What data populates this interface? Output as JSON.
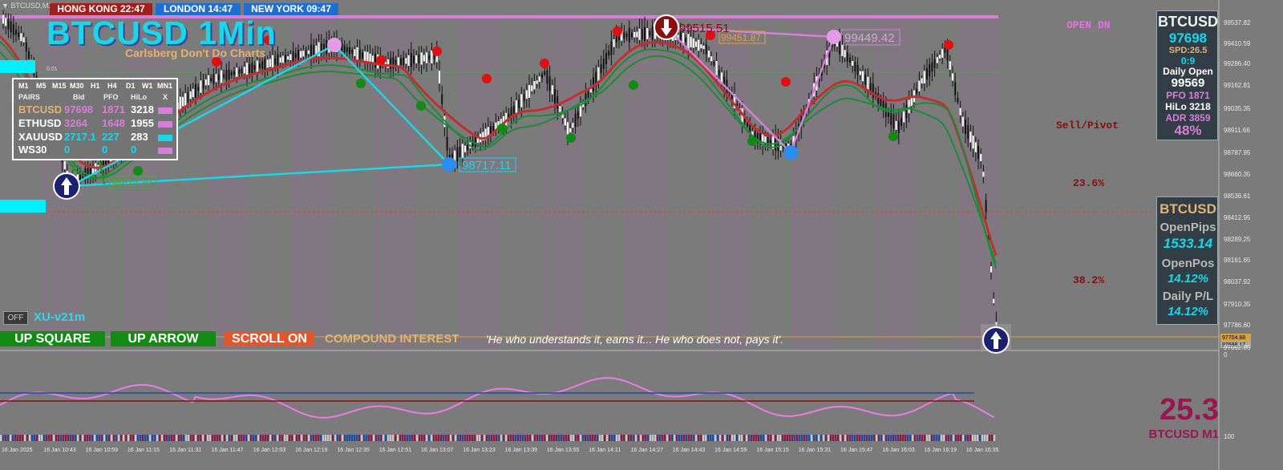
{
  "window": {
    "title": "▼ BTCUSD,M1"
  },
  "clocks": [
    {
      "label": "HONG KONG 22:47",
      "color": "#a02020"
    },
    {
      "label": "LONDON  14:47",
      "color": "#1f6fd0"
    },
    {
      "label": "NEW YORK  09:47",
      "color": "#1f6fd0"
    }
  ],
  "header": {
    "title": "BTCUSD 1Min",
    "tagline": "Carlsberg Don't Do Charts"
  },
  "pairs_panel": {
    "timeframes": [
      "M1",
      "M5",
      "M15",
      "M30",
      "H1",
      "H4",
      "D1",
      "W1",
      "MN1"
    ],
    "close_label": "X",
    "headers": {
      "pairs": "PAIRS",
      "bid": "Bid",
      "pfo": "PFO",
      "hilo": "HiLo"
    },
    "rows": [
      {
        "pair": "BTCUSD",
        "bid": "97698",
        "pfo": "1871",
        "hilo": "3218"
      },
      {
        "pair": "ETHUSD",
        "bid": "3264",
        "pfo": "1648",
        "hilo": "1955"
      },
      {
        "pair": "XAUUSD",
        "bid": "2717.1",
        "pfo": "227",
        "hilo": "283"
      },
      {
        "pair": "WS30",
        "bid": "0",
        "pfo": "0",
        "hilo": "0"
      }
    ]
  },
  "price_labels": {
    "high_main": "99515.51",
    "high_secondary": "99451.87",
    "high_right": "99449.42",
    "low_mid": "98717.11",
    "low_left": "98612.30",
    "small_tag": "0.01"
  },
  "levels": {
    "open_dn": "OPEN DN",
    "sell_pivot": "Sell/Pivot",
    "fib_236": "23.6%",
    "fib_382": "38.2%"
  },
  "info_panel": {
    "symbol": "BTCUSD",
    "price": "97698",
    "spread": "SPD:26.5",
    "ratio": "0:9",
    "daily_open_label": "Daily Open",
    "daily_open": "99569",
    "pfo": "PFO 1871",
    "hilo": "HiLo 3218",
    "adr": "ADR 3859",
    "pct": "48%"
  },
  "positions_panel": {
    "symbol": "BTCUSD",
    "open_pips_label": "OpenPips",
    "open_pips": "1533.14",
    "open_pos_label": "OpenPos",
    "open_pos": "14.12%",
    "daily_pl_label": "Daily P/L",
    "daily_pl": "14.12%"
  },
  "controls": {
    "off_label": "OFF",
    "version": "XU-v21m",
    "up_square": "UP SQUARE",
    "up_arrow": "UP ARROW",
    "scroll_on": "SCROLL ON",
    "compound_label": "COMPOUND INTEREST",
    "compound_quote": "'He who understands it, earns it... He who does not, pays it'."
  },
  "price_axis": [
    "99537.82",
    "99410.59",
    "99286.40",
    "99162.81",
    "99035.35",
    "98911.66",
    "98787.95",
    "98660.35",
    "98536.61",
    "98412.95",
    "98289.25",
    "98161.65",
    "98037.92",
    "97910.35",
    "97786.60",
    "97662.85"
  ],
  "price_axis_current": [
    "97704.88",
    "97698.17"
  ],
  "osc_axis": {
    "top": "0",
    "bottom": "100"
  },
  "oscillator": {
    "value": "25.3",
    "symbol": "BTCUSD M1"
  },
  "time_axis": [
    "16 Jan 2025",
    "16 Jan 10:43",
    "16 Jan 10:59",
    "16 Jan 11:15",
    "16 Jan 11:31",
    "16 Jan 11:47",
    "16 Jan 12:03",
    "16 Jan 12:19",
    "16 Jan 12:35",
    "16 Jan 12:51",
    "16 Jan 13:07",
    "16 Jan 13:23",
    "16 Jan 13:39",
    "16 Jan 13:55",
    "16 Jan 14:11",
    "16 Jan 14:27",
    "16 Jan 14:43",
    "16 Jan 14:59",
    "16 Jan 15:15",
    "16 Jan 15:31",
    "16 Jan 15:47",
    "16 Jan 16:03",
    "16 Jan 16:19",
    "16 Jan 16:35"
  ],
  "colors": {
    "cyan": "#19d6e8",
    "magenta": "#d77fd8",
    "red": "#e01010",
    "green": "#1a8a1a",
    "ma_red": "#c03030",
    "ma_green": "#1f8a3a",
    "panel_bg": "#333d45"
  }
}
